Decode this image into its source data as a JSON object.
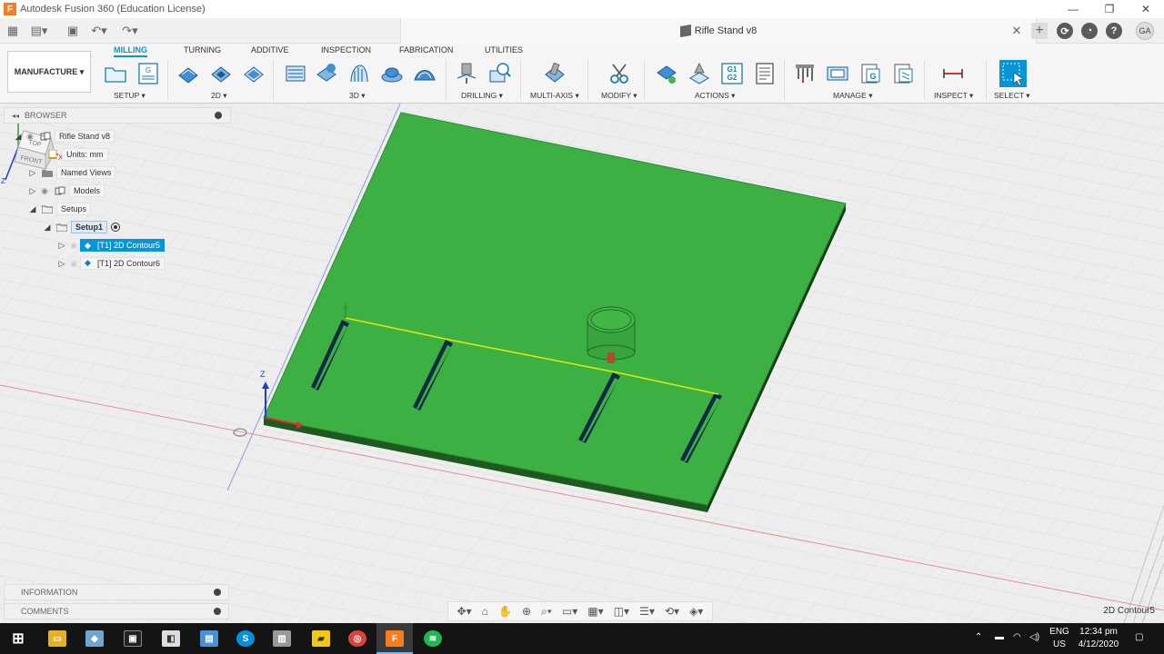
{
  "window": {
    "title": "Autodesk Fusion 360 (Education License)",
    "app_icon_letter": "F"
  },
  "document": {
    "tab_title": "Rifle Stand v8",
    "close_glyph": "✕",
    "add_glyph": "+"
  },
  "user": {
    "initials": "GA"
  },
  "ribbon": {
    "workspace": "MANUFACTURE",
    "tabs": [
      "MILLING",
      "TURNING",
      "ADDITIVE",
      "INSPECTION",
      "FABRICATION",
      "UTILITIES"
    ],
    "active_tab": "MILLING",
    "groups": [
      "SETUP",
      "2D",
      "3D",
      "DRILLING",
      "MULTI-AXIS",
      "MODIFY",
      "ACTIONS",
      "MANAGE",
      "INSPECT",
      "SELECT"
    ]
  },
  "browser": {
    "header": "BROWSER",
    "items": [
      {
        "label": "Rifle Stand v8"
      },
      {
        "label": "Units: mm"
      },
      {
        "label": "Named Views"
      },
      {
        "label": "Models"
      },
      {
        "label": "Setups"
      },
      {
        "label": "Setup1"
      },
      {
        "label": "[T1] 2D Contour5"
      },
      {
        "label": "[T1] 2D Contour6"
      }
    ]
  },
  "panels": {
    "information": "INFORMATION",
    "comments": "COMMENTS"
  },
  "viewcube": {
    "top": "TOP",
    "front": "FRONT",
    "axis_x": "X",
    "axis_y": "Y",
    "axis_z": "Z"
  },
  "viewport": {
    "axis_z_label": "Z",
    "status": "2D Contour5"
  },
  "taskbar": {
    "lang": "ENG",
    "region": "US",
    "time": "12:34 pm",
    "date": "4/12/2020"
  },
  "colors": {
    "accent": "#0696d7",
    "stock": "#3cb043",
    "stock_side": "#1e5a20",
    "fusion_orange": "#f57f20"
  }
}
